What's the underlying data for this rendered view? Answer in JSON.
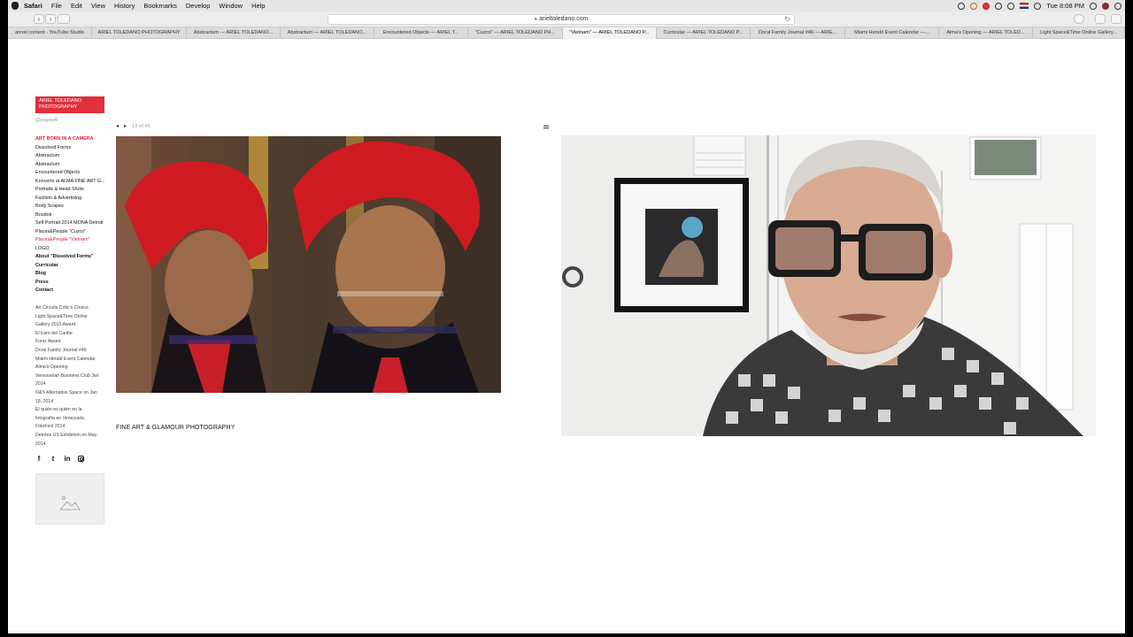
{
  "menubar": {
    "app": "Safari",
    "items": [
      "File",
      "Edit",
      "View",
      "History",
      "Bookmarks",
      "Develop",
      "Window",
      "Help"
    ],
    "clock": "Tue 8:08 PM"
  },
  "toolbar": {
    "back": "‹",
    "forward": "›",
    "url": "arieltoledano.com"
  },
  "tabs": [
    "annel content - YouTube Studio",
    "ARIEL TOLEDANO PHOTOGRAPHY",
    "Abstractum — ARIEL TOLEDANO...",
    "Abstractum — ARIEL TOLEDANO...",
    "Encountered Objects — ARIEL T...",
    "\"Cuzco\" — ARIEL TOLEDANO PH...",
    "\"Vietnam\" — ARIEL TOLEDANO P...",
    "Curricular — ARIEL TOLEDANO P...",
    "Doral Family Journal #46 — ARIE...",
    "Miami Herald Event Calendar —...",
    "Alma's Opening — ARIEL TOLED...",
    "Light Space&Time Online Gallery..."
  ],
  "site": {
    "logo": "ARIEL TOLEDANO PHOTOGRAPHY",
    "handle": "@papayili",
    "nav": [
      {
        "label": "ART BORN IN A CAMERA",
        "kind": "section"
      },
      {
        "label": "Dissolved Forms",
        "kind": "normal"
      },
      {
        "label": "Abstractum",
        "kind": "normal"
      },
      {
        "label": "Abstractum",
        "kind": "normal"
      },
      {
        "label": "Encountered Objects",
        "kind": "normal"
      },
      {
        "label": "Koncerts at ALMA FINE ART G...",
        "kind": "normal"
      },
      {
        "label": "Portraits & Head Shots",
        "kind": "normal"
      },
      {
        "label": "Fashion & Advertising",
        "kind": "normal"
      },
      {
        "label": "Body Scapes",
        "kind": "normal"
      },
      {
        "label": "Boudoir",
        "kind": "normal"
      },
      {
        "label": "Self Portrait 2014 MONA Detroit",
        "kind": "normal"
      },
      {
        "label": "Places&People \"Cuzco\"",
        "kind": "normal"
      },
      {
        "label": "Places&People \"Vietnam\"",
        "kind": "current"
      },
      {
        "label": "LOGO",
        "kind": "normal"
      },
      {
        "label": "About \"Dissolved Forms\"",
        "kind": "bold"
      },
      {
        "label": "Curricular",
        "kind": "bold"
      },
      {
        "label": "Blog",
        "kind": "bold"
      },
      {
        "label": "Press",
        "kind": "bold"
      },
      {
        "label": "Contact",
        "kind": "bold"
      }
    ],
    "links": [
      "Art Circuits Critic's Choice",
      "Light Space&Time Online",
      "Gallery 2013 Award",
      "El Faro del Caribe",
      "Fonix Award",
      "Doral Family Journal #46",
      "Miami Herald Event Calendar",
      "Alma's Opening",
      "Venezuelan Business Club Jan",
      "2014",
      "O&S Alternative Space on Jan",
      "18, 2014",
      "El quién es quién en la",
      "fotografía en Venezuela.",
      "FotoFest 2014",
      "Detrées US Exhibition on May",
      "2014"
    ],
    "socials": [
      {
        "name": "facebook-icon",
        "glyph": "f"
      },
      {
        "name": "twitter-icon",
        "glyph": "t"
      },
      {
        "name": "linkedin-icon",
        "glyph": "in"
      },
      {
        "name": "instagram-icon",
        "glyph": ""
      }
    ],
    "pager": {
      "prev": "◂",
      "next": "▸",
      "counter": "13 of 45"
    },
    "caption": "FINE ART & GLAMOUR PHOTOGRAPHY"
  },
  "colors": {
    "brand_red": "#e0303c",
    "nav_red": "#d9223a",
    "hat_red": "#d01a22"
  }
}
